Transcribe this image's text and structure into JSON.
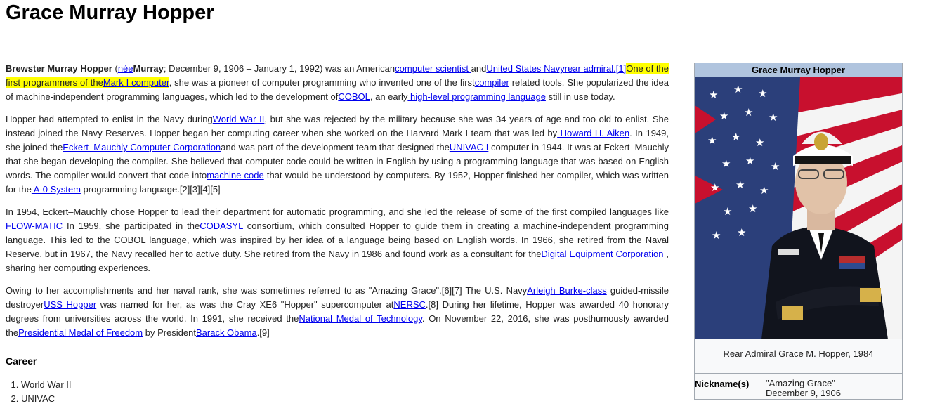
{
  "page": {
    "title": "Grace Murray Hopper"
  },
  "infobox": {
    "title": "Grace Murray Hopper",
    "caption": "Rear Admiral Grace M. Hopper, 1984",
    "nickname_label": "Nickname(s)",
    "nickname_value": "\"Amazing Grace\"",
    "born_value": "December 9, 1906"
  },
  "p1": {
    "t01": "Brewster Murray Hopper",
    "t02": " (",
    "l01": "née",
    "t03": "Murray",
    "t04": "; December 9, 1906 – January 1, 1992) was an American",
    "l02": "computer scientist ",
    "t05": "and",
    "l03": "United States Navy",
    "l04": "rear admiral",
    "l05": ".[1]",
    "h01": "One of the first programmers of the",
    "l06": "Mark I computer",
    "t06": ", she was a pioneer of computer programming who invented one of the first",
    "l07": "compiler",
    "t07": " related tools. She popularized the idea of machine-independent programming languages, which led to the development of",
    "l08": "COBOL",
    "t08": ", an early",
    "l09": " high-level programming language",
    "t09": " still in use today."
  },
  "p2": {
    "t01": "Hopper had attempted to enlist in the Navy during",
    "l01": "World War II",
    "t02": ", but she was rejected by the military because she was 34 years of age and too old to enlist. She instead joined the Navy Reserves. Hopper began her computing career when she worked on the Harvard Mark I team that was led by",
    "l02": " Howard H. Aiken",
    "t03": ". In 1949, she joined the",
    "l03": "Eckert–Mauchly Computer Corporation",
    "t04": "and was part of the development team that designed the",
    "l04": "UNIVAC I",
    "t05": " computer in 1944. It was at Eckert–Mauchly that she began developing the compiler. She believed that computer code could be written in English by using a programming language that was based on English words. The compiler would convert that code into",
    "l05": "machine code",
    "t06": " that would be understood by computers. By 1952, Hopper finished her compiler, which was written for the",
    "l06": " A-0 System",
    "t07": " programming language.[2][3][4][5]"
  },
  "p3": {
    "t01": "In 1954, Eckert–Mauchly chose Hopper to lead their department for automatic programming, and she led the release of some of the first compiled languages like",
    "l01": " FLOW-MATIC",
    "t02": " In 1959, she participated in the",
    "l02": "CODASYL",
    "t03": " consortium, which consulted Hopper to guide them in creating a machine-independent programming language. This led to the COBOL language, which was inspired by her idea of a language being based on English words. In 1966, she retired from the Naval Reserve, but in 1967, the Navy recalled her to active duty. She retired from the Navy in 1986 and found work as a consultant for the",
    "l03": "Digital Equipment Corporation",
    "t04": " , sharing her computing experiences."
  },
  "p4": {
    "t01": "Owing to her accomplishments and her naval rank, she was sometimes referred to as \"Amazing Grace\".[6][7] The U.S. Navy",
    "l01": "Arleigh Burke-class",
    "t02": " guided-missile destroyer",
    "l02": "USS Hopper",
    "t03": " was named for her, as was the Cray XE6 \"Hopper\" supercomputer at",
    "l03": "NERSC",
    "t04": ".[8] During her lifetime, Hopper was awarded 40 honorary degrees from universities across the world. In 1991, she received the",
    "l04": "National Medal of Technology",
    "t05": ". On November 22, 2016, she was posthumously awarded the",
    "l05": "Presidential Medal of Freedom",
    "t06": " by President",
    "l06": "Barack Obama",
    "t07": ".[9]"
  },
  "career": {
    "heading": "Career",
    "items": [
      "World War II",
      "UNIVAC"
    ]
  }
}
